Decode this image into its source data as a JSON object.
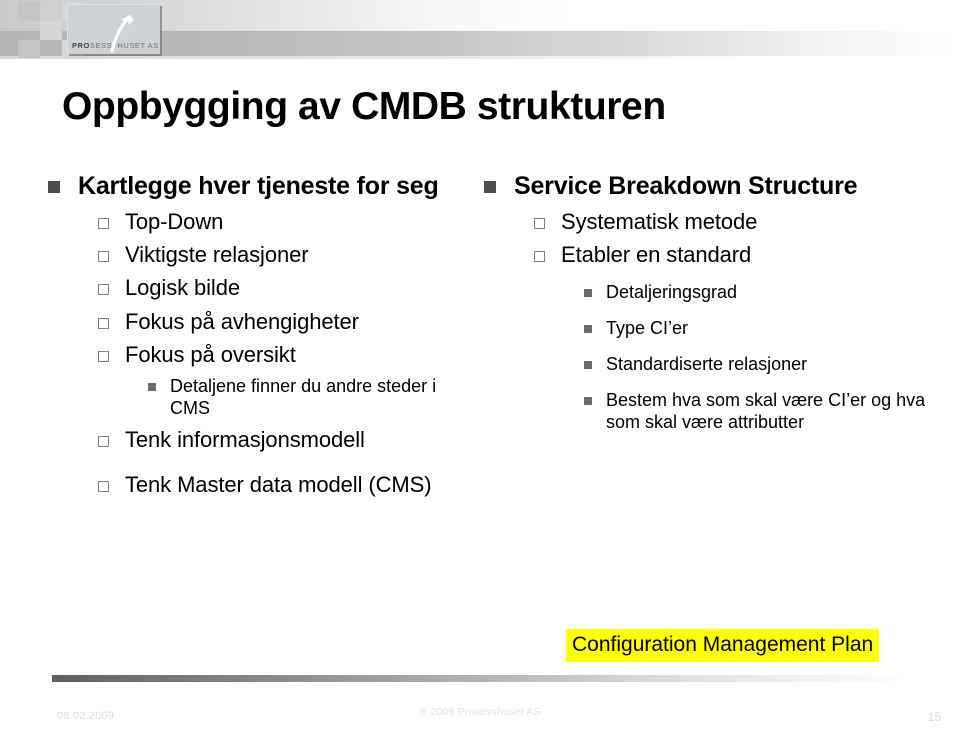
{
  "header": {
    "logo": {
      "icon": "upward-arrow-icon",
      "text_bold": "PRO",
      "text_rest": "SESS",
      "text_second": "HUSET AS"
    }
  },
  "slide": {
    "title": "Oppbygging av CMDB strukturen"
  },
  "left_column": {
    "l1": "Kartlegge hver tjeneste for seg",
    "items": [
      {
        "level": 2,
        "text": "Top-Down"
      },
      {
        "level": 2,
        "text": "Viktigste relasjoner"
      },
      {
        "level": 2,
        "text": "Logisk bilde"
      },
      {
        "level": 2,
        "text": "Fokus på avhengigheter"
      },
      {
        "level": 2,
        "text": "Fokus på oversikt"
      },
      {
        "level": 3,
        "text": "Detaljene finner du andre steder i CMS"
      },
      {
        "level": 2,
        "text": "Tenk informasjonsmodell"
      },
      {
        "level": 2,
        "text": "Tenk Master data modell (CMS)"
      }
    ]
  },
  "right_column": {
    "l1": "Service Breakdown Structure",
    "items": [
      {
        "level": 2,
        "text": "Systematisk metode"
      },
      {
        "level": 2,
        "text": "Etabler en standard"
      },
      {
        "level": 3,
        "text": "Detaljeringsgrad"
      },
      {
        "level": 3,
        "text": "Type CI’er"
      },
      {
        "level": 3,
        "text": "Standardiserte relasjoner"
      },
      {
        "level": 3,
        "text": "Bestem hva som skal være CI’er og hva som skal være attributter"
      }
    ]
  },
  "highlight": {
    "text": "Configuration Management Plan",
    "color": "#ffff00"
  },
  "footer": {
    "date": "08.02.2009",
    "copyright": "® 2008 Prosesshuset AS",
    "page_number": "15"
  }
}
